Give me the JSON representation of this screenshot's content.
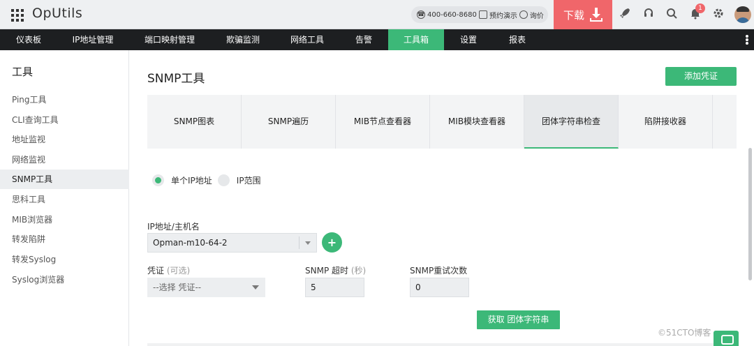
{
  "app": {
    "name": "OpUtils"
  },
  "topbar": {
    "phone": "400-660-8680",
    "demo_label": "预约演示",
    "inquiry_label": "询价",
    "download_label": "下载",
    "notification_count": "1",
    "icons": [
      "apps-grid-icon",
      "phone-icon",
      "calendar-icon",
      "chat-icon",
      "download-icon",
      "rocket-icon",
      "headset-icon",
      "search-icon",
      "bell-icon",
      "gear-icon",
      "user-avatar"
    ]
  },
  "nav": {
    "items": [
      {
        "label": "仪表板"
      },
      {
        "label": "IP地址管理"
      },
      {
        "label": "端口映射管理"
      },
      {
        "label": "欺骗监测"
      },
      {
        "label": "网络工具"
      },
      {
        "label": "告警"
      },
      {
        "label": "工具箱"
      },
      {
        "label": "设置"
      },
      {
        "label": "报表"
      }
    ],
    "active_index": 6
  },
  "sidebar": {
    "title": "工具",
    "items": [
      {
        "label": "Ping工具"
      },
      {
        "label": "CLI查询工具"
      },
      {
        "label": "地址监视"
      },
      {
        "label": "网络监视"
      },
      {
        "label": "SNMP工具"
      },
      {
        "label": "思科工具"
      },
      {
        "label": "MIB浏览器"
      },
      {
        "label": "转发陷阱"
      },
      {
        "label": "转发Syslog"
      },
      {
        "label": "Syslog浏览器"
      }
    ],
    "active_index": 4
  },
  "main": {
    "title": "SNMP工具",
    "add_credential_label": "添加凭证",
    "tabs": [
      {
        "label": "SNMP图表"
      },
      {
        "label": "SNMP遍历"
      },
      {
        "label": "MIB节点查看器"
      },
      {
        "label": "MIB模块查看器"
      },
      {
        "label": "团体字符串检查"
      },
      {
        "label": "陷阱接收器"
      }
    ],
    "active_tab_index": 4,
    "radio_single": "单个IP地址",
    "radio_range": "IP范围",
    "selected_mode": "single",
    "ip_label": "IP地址/主机名",
    "ip_value": "Opman-m10-64-2",
    "credential_label": "凭证",
    "credential_hint": "(可选)",
    "credential_value": "--选择 凭证--",
    "timeout_label": "SNMP 超时",
    "timeout_hint": "(秒)",
    "timeout_value": "5",
    "retry_label": "SNMP重试次数",
    "retry_value": "0",
    "fetch_label": "获取 团体字符串"
  },
  "watermark": "©51CTO博客",
  "colors": {
    "accent": "#3cb878",
    "download": "#f0666a",
    "navbar": "#1d1f21"
  }
}
